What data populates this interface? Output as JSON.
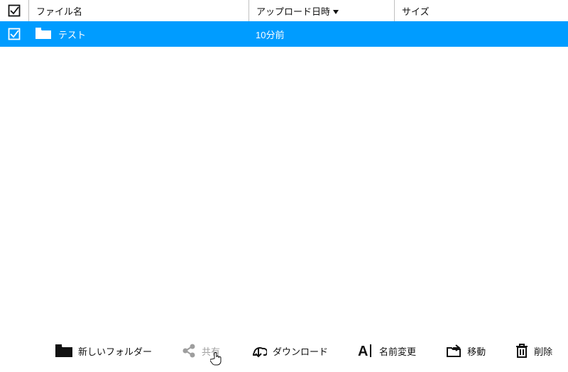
{
  "columns": {
    "name": "ファイル名",
    "upload": "アップロード日時",
    "size": "サイズ"
  },
  "rows": [
    {
      "name": "テスト",
      "upload": "10分前",
      "size": ""
    }
  ],
  "toolbar": {
    "new_folder": "新しいフォルダー",
    "share": "共有",
    "download": "ダウンロード",
    "rename": "名前変更",
    "move": "移動",
    "delete": "削除"
  },
  "colors": {
    "selection": "#009cff"
  }
}
